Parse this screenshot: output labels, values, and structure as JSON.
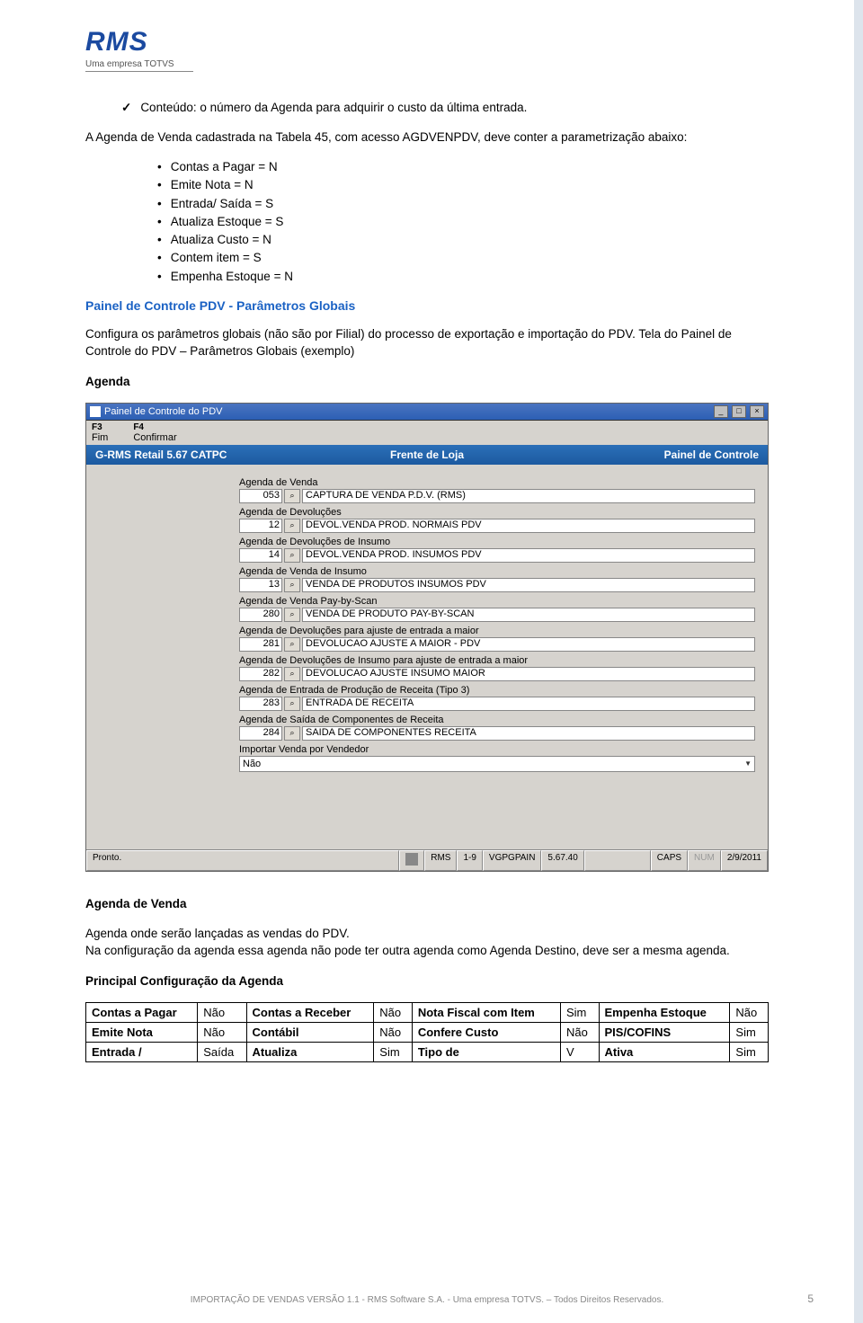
{
  "logo": {
    "main": "RMS",
    "sub": "Uma empresa TOTVS"
  },
  "content": {
    "check_item": "Conteúdo: o número da Agenda para adquirir o custo da última entrada.",
    "para1": "A Agenda de Venda cadastrada na Tabela 45, com acesso AGDVENPDV, deve conter a parametrização abaixo:",
    "params": [
      "Contas a Pagar = N",
      "Emite Nota = N",
      "Entrada/ Saída = S",
      "Atualiza Estoque = S",
      "Atualiza Custo = N",
      "Contem item = S",
      "Empenha Estoque = N"
    ],
    "heading1": "Painel de Controle PDV - Parâmetros Globais",
    "para2": "Configura os parâmetros globais (não são por Filial) do processo de exportação e importação do PDV. Tela do Painel de Controle do PDV – Parâmetros Globais (exemplo)",
    "agenda_label": "Agenda",
    "heading2": "Agenda de Venda",
    "para3a": "Agenda onde serão lançadas as vendas do PDV.",
    "para3b": "Na configuração da agenda essa agenda não pode ter outra agenda como Agenda Destino, deve ser a mesma agenda.",
    "heading3": "Principal Configuração da Agenda"
  },
  "app": {
    "title": "Painel de Controle do PDV",
    "menu": [
      {
        "fkey": "F3",
        "label": "Fim"
      },
      {
        "fkey": "F4",
        "label": "Confirmar"
      }
    ],
    "bluebar": {
      "left": "G-RMS Retail 5.67 CATPC",
      "center": "Frente de Loja",
      "right": "Painel de Controle"
    },
    "rows": [
      {
        "label": "Agenda de Venda",
        "code": "053",
        "desc": "CAPTURA DE VENDA P.D.V. (RMS)"
      },
      {
        "label": "Agenda de Devoluções",
        "code": "12",
        "desc": "DEVOL.VENDA PROD. NORMAIS PDV"
      },
      {
        "label": "Agenda de Devoluções de Insumo",
        "code": "14",
        "desc": "DEVOL.VENDA PROD. INSUMOS PDV"
      },
      {
        "label": "Agenda de Venda de Insumo",
        "code": "13",
        "desc": "VENDA DE PRODUTOS INSUMOS PDV"
      },
      {
        "label": "Agenda de Venda Pay-by-Scan",
        "code": "280",
        "desc": "VENDA DE PRODUTO PAY-BY-SCAN"
      },
      {
        "label": "Agenda de Devoluções para ajuste de entrada a maior",
        "code": "281",
        "desc": "DEVOLUCAO AJUSTE A MAIOR - PDV"
      },
      {
        "label": "Agenda de Devoluções de Insumo para ajuste de entrada a maior",
        "code": "282",
        "desc": "DEVOLUCAO AJUSTE INSUMO MAIOR"
      },
      {
        "label": "Agenda de Entrada de Produção de Receita (Tipo 3)",
        "code": "283",
        "desc": "ENTRADA DE RECEITA"
      },
      {
        "label": "Agenda de Saída de Componentes de Receita",
        "code": "284",
        "desc": "SAIDA DE COMPONENTES RECEITA"
      }
    ],
    "select_row": {
      "label": "Importar Venda por Vendedor",
      "value": "Não"
    },
    "status": {
      "ready": "Pronto.",
      "user": "RMS",
      "page": "1-9",
      "prog": "VGPGPAIN",
      "ver": "5.67.40",
      "caps": "CAPS",
      "num": "NUM",
      "date": "2/9/2011"
    }
  },
  "cfg_table": {
    "r1": {
      "c1": "Contas a Pagar",
      "c2": "Não",
      "c3": "Contas a Receber",
      "c4": "Não",
      "c5": "Nota Fiscal com Item",
      "c6": "Sim",
      "c7": "Empenha Estoque",
      "c8": "Não"
    },
    "r2": {
      "c1": "Emite Nota",
      "c2": "Não",
      "c3": "Contábil",
      "c4": "Não",
      "c5": "Confere Custo",
      "c6": "Não",
      "c7": "PIS/COFINS",
      "c8": "Sim"
    },
    "r3": {
      "c1": "Entrada /",
      "c2": "Saída",
      "c3": "Atualiza",
      "c4": "Sim",
      "c5": "Tipo de",
      "c6": "V",
      "c7": "Ativa",
      "c8": "Sim"
    }
  },
  "footer": {
    "text": "IMPORTAÇÃO DE VENDAS VERSÃO 1.1 - RMS Software S.A. - Uma empresa TOTVS. – Todos Direitos Reservados.",
    "page": "5"
  }
}
